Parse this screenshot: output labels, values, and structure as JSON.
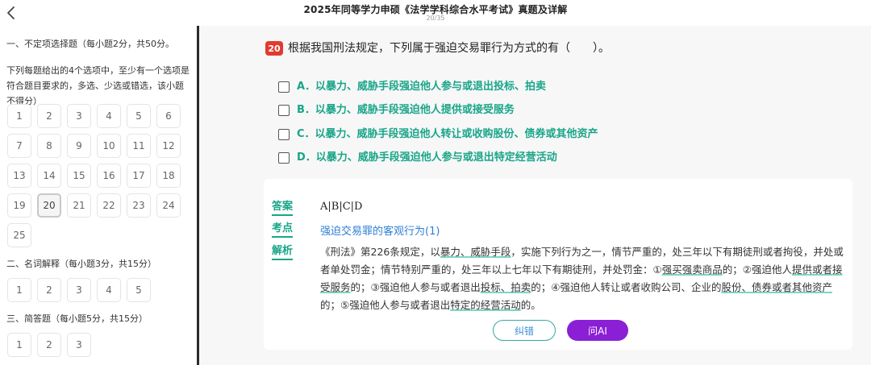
{
  "header": {
    "title": "2025年同等学力申硕《法学学科综合水平考试》真题及详解",
    "page_indicator": "20/35",
    "back_icon": "chevron-left-icon"
  },
  "sidebar": {
    "sections": [
      {
        "title": "一、不定项选择题（每小题2分，共50分。",
        "desc": "下列每题给出的4个选项中，至少有一个选项是符合题目要求的，多选、少选或错选，该小题不得分）",
        "questions": [
          "1",
          "2",
          "3",
          "4",
          "5",
          "6",
          "7",
          "8",
          "9",
          "10",
          "11",
          "12",
          "13",
          "14",
          "15",
          "16",
          "17",
          "18",
          "19",
          "20",
          "21",
          "22",
          "23",
          "24",
          "25"
        ],
        "current": "20"
      },
      {
        "title": "二、名词解释（每小题3分，共15分）",
        "questions": [
          "1",
          "2",
          "3",
          "4",
          "5"
        ]
      },
      {
        "title": "三、简答题（每小题5分，共15分）",
        "questions": [
          "1",
          "2",
          "3"
        ]
      }
    ]
  },
  "question": {
    "number": "20",
    "stem": "根据我国刑法规定，下列属于强迫交易罪行为方式的有（　　）。",
    "options": [
      "A．以暴力、威胁手段强迫他人参与或退出投标、拍卖",
      "B．以暴力、威胁手段强迫他人提供或接受服务",
      "C．以暴力、威胁手段强迫他人转让或收购股份、债券或其他资产",
      "D．以暴力、威胁手段强迫他人参与或退出特定经营活动"
    ]
  },
  "analysis": {
    "answer_label": "答案",
    "answer": "A|B|C|D",
    "point_label": "考点",
    "point": "强迫交易罪的客观行为(1)",
    "explain_label": "解析",
    "explain_parts": [
      {
        "t": "《刑法》第226条规定，以"
      },
      {
        "t": "暴力、威胁手段",
        "hl": true
      },
      {
        "t": "，实施下列行为之一，情节严重的，处三年以下有期徒刑或者拘役，并处或者单处罚金；情节特别严重的，处三年以上七年以下有期徒刑，并处罚金：①"
      },
      {
        "t": "强买强卖商品",
        "hl": true
      },
      {
        "t": "的；②强迫他人"
      },
      {
        "t": "提供或者接受服务",
        "hl": true
      },
      {
        "t": "的；③强迫他人参与或者退出"
      },
      {
        "t": "投标、拍卖",
        "hl": true
      },
      {
        "t": "的；④强迫他人转让或者收购公司、企业的"
      },
      {
        "t": "股份、债券或者其他资产",
        "hl": true
      },
      {
        "t": "的；⑤强迫他人参与或者退出"
      },
      {
        "t": "特定的经营活动",
        "hl": true
      },
      {
        "t": "的。"
      }
    ],
    "correct_button": "纠错",
    "ai_button": "问AI"
  },
  "colors": {
    "accent_green": "#19a589",
    "question_badge": "#e13a32",
    "ai_button": "#8a1fd6",
    "link_blue": "#2e7fd6"
  }
}
